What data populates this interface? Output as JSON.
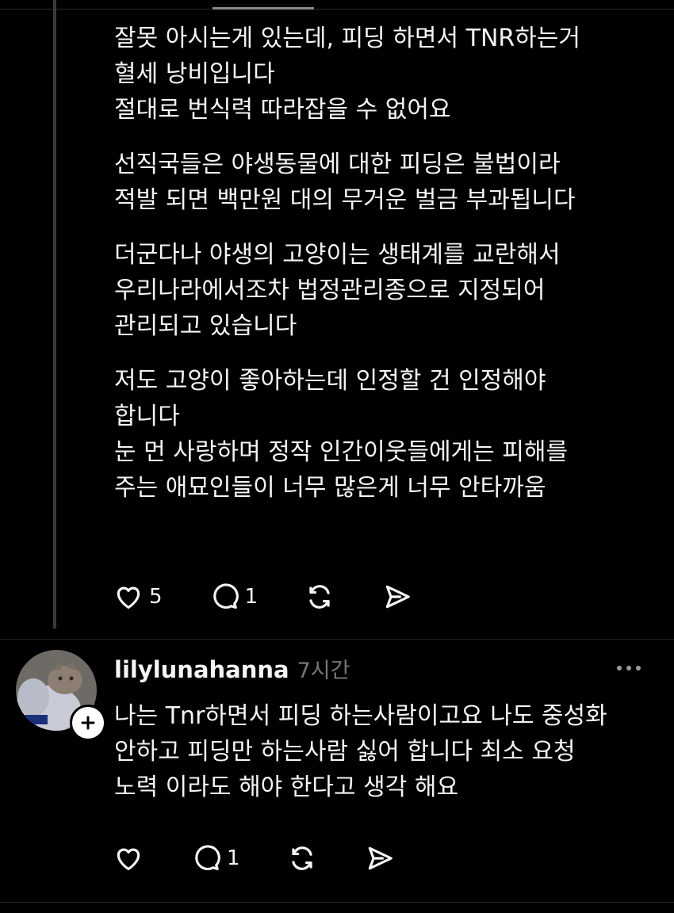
{
  "post1": {
    "paragraphs": [
      [
        "잘못 아시는게 있는데, 피딩 하면서 TNR하는거",
        "혈세 낭비입니다",
        "절대로 번식력 따라잡을 수 없어요"
      ],
      [
        "선직국들은 야생동물에 대한 피딩은 불법이라",
        "적발 되면 백만원 대의 무거운 벌금 부과됩니다"
      ],
      [
        "더군다나 야생의 고양이는 생태계를 교란해서",
        "우리나라에서조차 법정관리종으로 지정되어",
        "관리되고 있습니다"
      ],
      [
        "저도 고양이 좋아하는데 인정할 건 인정해야",
        "합니다",
        "눈 먼 사랑하며 정작 인간이웃들에게는 피해를",
        "주는 애묘인들이 너무 많은게 너무 안타까움"
      ]
    ],
    "likes": "5",
    "replies": "1"
  },
  "post2": {
    "username": "lilylunahanna",
    "time": "7시간",
    "lines": [
      "나는 Tnr하면서 피딩 하는사람이고요 나도 중성화",
      "안하고 피딩만 하는사람 싫어 합니다 최소 요청",
      "노력 이라도 해야 한다고 생각 해요"
    ],
    "likes": "",
    "replies": "1"
  },
  "icons": {
    "like": "heart-icon",
    "reply": "comment-bubble-icon",
    "repost": "repost-arrows-icon",
    "share": "send-arrow-icon",
    "more": "more-dots-icon",
    "follow": "plus-icon"
  },
  "colors": {
    "background": "#000000",
    "text": "#f3f5f7",
    "muted": "#777777",
    "thread_line": "#3a3a3a"
  }
}
